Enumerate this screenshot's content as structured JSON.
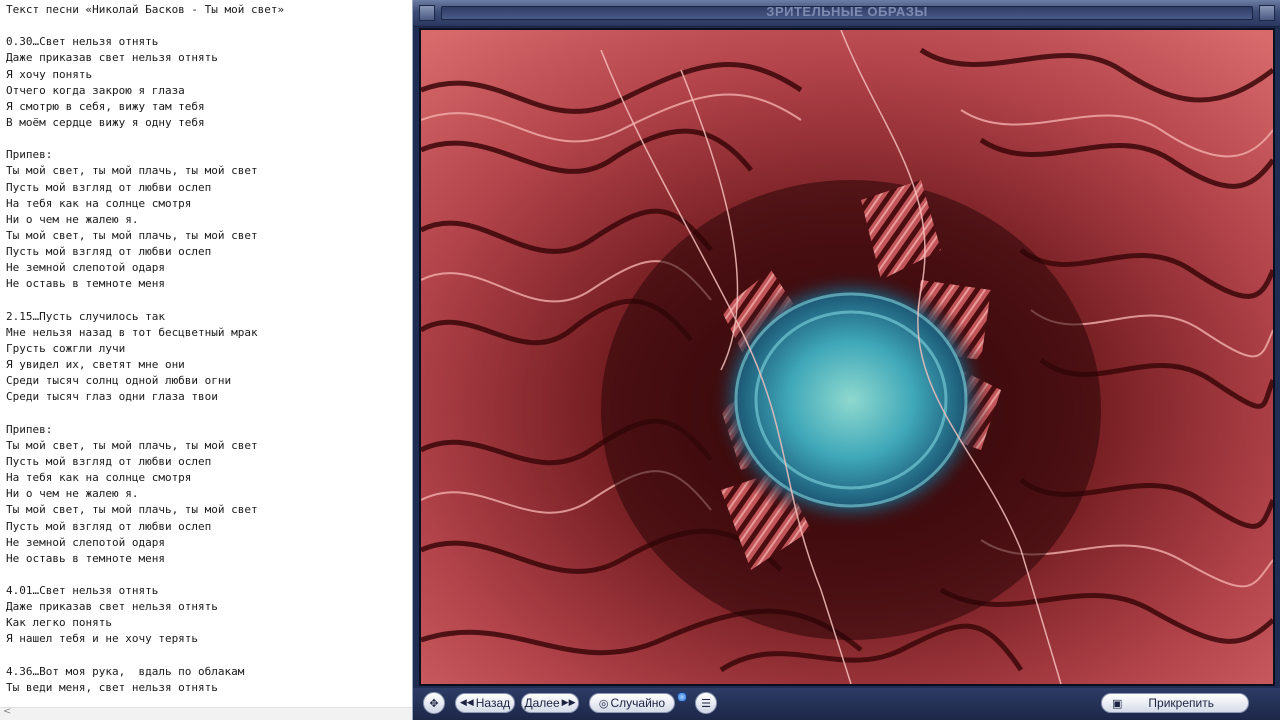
{
  "notepad": {
    "lines": [
      "Текст песни «Николай Басков - Ты мой свет»",
      "",
      "0.30…Свет нельзя отнять",
      "Даже приказав свет нельзя отнять",
      "Я хочу понять",
      "Отчего когда закрою я глаза",
      "Я смотрю в себя, вижу там тебя",
      "В моём сердце вижу я одну тебя",
      "",
      "Припев:",
      "Ты мой свет, ты мой плачь, ты мой свет",
      "Пусть мой взгляд от любви ослеп",
      "На тебя как на солнце смотря",
      "Ни о чем не жалею я.",
      "Ты мой свет, ты мой плачь, ты мой свет",
      "Пусть мой взгляд от любви ослеп",
      "Не земной слепотой одаря",
      "Не оставь в темноте меня",
      "",
      "2.15…Пусть случилось так",
      "Мне нельзя назад в тот бесцветный мрак",
      "Грусть сожгли лучи",
      "Я увидел их, светят мне они",
      "Среди тысяч солнц одной любви огни",
      "Среди тысяч глаз одни глаза твои",
      "",
      "Припев:",
      "Ты мой свет, ты мой плачь, ты мой свет",
      "Пусть мой взгляд от любви ослеп",
      "На тебя как на солнце смотря",
      "Ни о чем не жалею я.",
      "Ты мой свет, ты мой плачь, ты мой свет",
      "Пусть мой взгляд от любви ослеп",
      "Не земной слепотой одаря",
      "Не оставь в темноте меня",
      "",
      "4.01…Свет нельзя отнять",
      "Даже приказав свет нельзя отнять",
      "Как легко понять",
      "Я нашел тебя и не хочу терять",
      "",
      "4.36…Вот моя рука,  вдаль по облакам",
      "Ты веди меня, свет нельзя отнять"
    ],
    "scroll_arrow": "<"
  },
  "player": {
    "title": "ЗРИТЕЛЬНЫЕ ОБРАЗЫ",
    "controls": {
      "back_label": "Назад",
      "next_label": "Далее",
      "random_label": "Случайно",
      "pin_label": "Прикрепить",
      "back_icon": "rewind-icon",
      "next_icon": "fast-forward-icon",
      "random_icon": "shuffle-icon",
      "menu_icon": "menu-list-icon",
      "move_icon": "move-crosshair-icon",
      "pin_icon": "pin-window-icon"
    },
    "colors": {
      "chrome": "#1f2d52",
      "viz_red": "#c9555a",
      "viz_cyan": "#5fc2c9"
    }
  }
}
